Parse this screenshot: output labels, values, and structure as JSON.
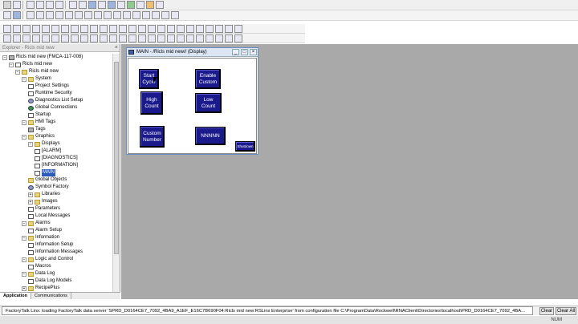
{
  "explorer": {
    "title": "Explorer - Ricls mid new",
    "close": "×",
    "tree": [
      {
        "label": "Ricls mid new (FMCA-117-008)",
        "depth": 0,
        "icon": "computer-icon",
        "exp": "−"
      },
      {
        "label": "Ricls mid new",
        "depth": 1,
        "icon": "app-icon",
        "exp": "−"
      },
      {
        "label": "Ricls mid new",
        "depth": 2,
        "icon": "folder-icon",
        "exp": "−"
      },
      {
        "label": "System",
        "depth": 3,
        "icon": "folder-icon",
        "exp": "−"
      },
      {
        "label": "Project Settings",
        "depth": 4,
        "icon": "page-icon"
      },
      {
        "label": "Runtime Security",
        "depth": 4,
        "icon": "page-icon"
      },
      {
        "label": "Diagnostics List Setup",
        "depth": 4,
        "icon": "gear-icon"
      },
      {
        "label": "Global Connections",
        "depth": 4,
        "icon": "globe-icon"
      },
      {
        "label": "Startup",
        "depth": 4,
        "icon": "page-icon"
      },
      {
        "label": "HMI Tags",
        "depth": 3,
        "icon": "folder-icon",
        "exp": "−"
      },
      {
        "label": "Tags",
        "depth": 4,
        "icon": "tag-icon"
      },
      {
        "label": "Graphics",
        "depth": 3,
        "icon": "folder-icon",
        "exp": "−"
      },
      {
        "label": "Displays",
        "depth": 4,
        "icon": "folder-icon",
        "exp": "−"
      },
      {
        "label": "[ALARM]",
        "depth": 5,
        "icon": "page-icon"
      },
      {
        "label": "[DIAGNOSTICS]",
        "depth": 5,
        "icon": "page-icon"
      },
      {
        "label": "[INFORMATION]",
        "depth": 5,
        "icon": "page-icon"
      },
      {
        "label": "MAIN",
        "depth": 5,
        "icon": "page-icon",
        "selected": true
      },
      {
        "label": "Global Objects",
        "depth": 4,
        "icon": "folder-icon"
      },
      {
        "label": "Symbol Factory",
        "depth": 4,
        "icon": "gear-icon"
      },
      {
        "label": "Libraries",
        "depth": 4,
        "icon": "folder-icon",
        "exp": "+"
      },
      {
        "label": "Images",
        "depth": 4,
        "icon": "folder-icon",
        "exp": "+"
      },
      {
        "label": "Parameters",
        "depth": 4,
        "icon": "page-icon"
      },
      {
        "label": "Local Messages",
        "depth": 4,
        "icon": "page-icon"
      },
      {
        "label": "Alarms",
        "depth": 3,
        "icon": "folder-icon",
        "exp": "−"
      },
      {
        "label": "Alarm Setup",
        "depth": 4,
        "icon": "page-icon"
      },
      {
        "label": "Information",
        "depth": 3,
        "icon": "folder-icon",
        "exp": "−"
      },
      {
        "label": "Information Setup",
        "depth": 4,
        "icon": "page-icon"
      },
      {
        "label": "Information Messages",
        "depth": 4,
        "icon": "page-icon"
      },
      {
        "label": "Logic and Control",
        "depth": 3,
        "icon": "folder-icon",
        "exp": "−"
      },
      {
        "label": "Macros",
        "depth": 4,
        "icon": "page-icon"
      },
      {
        "label": "Data Log",
        "depth": 3,
        "icon": "folder-icon",
        "exp": "−"
      },
      {
        "label": "Data Log Models",
        "depth": 4,
        "icon": "page-icon"
      },
      {
        "label": "RecipePlus",
        "depth": 3,
        "icon": "folder-icon",
        "exp": "+"
      }
    ],
    "tabs": [
      "Application",
      "Communications"
    ]
  },
  "display_window": {
    "title": "MAIN - /Ricls mid new// (Display)",
    "buttons": {
      "start_cycle": [
        "Start",
        "Cycle"
      ],
      "enable_custom": [
        "Enable",
        "Custom"
      ],
      "high_count": [
        "High",
        "Count"
      ],
      "low_count": [
        "Low",
        "Count"
      ],
      "custom_number": [
        "Custom",
        "Number"
      ],
      "numeric_display": "NNNNN",
      "shutdown": "Shutdown"
    }
  },
  "status": {
    "message": "FactoryTalk Linx: loading FactoryTalk data server 'SPRD_D0164CE7_7092_4BA9_A1EF_E16C7B690F04:Ricls mid new:RSLinx Enterprise' from configuration file C:\\ProgramData\\Rockwell\\RNAClient\\Directories\\localhost\\PRD_D0164CE7_7092_4BA...",
    "clear": "Clear",
    "clear_all": "Clear All",
    "num": "NUM"
  }
}
